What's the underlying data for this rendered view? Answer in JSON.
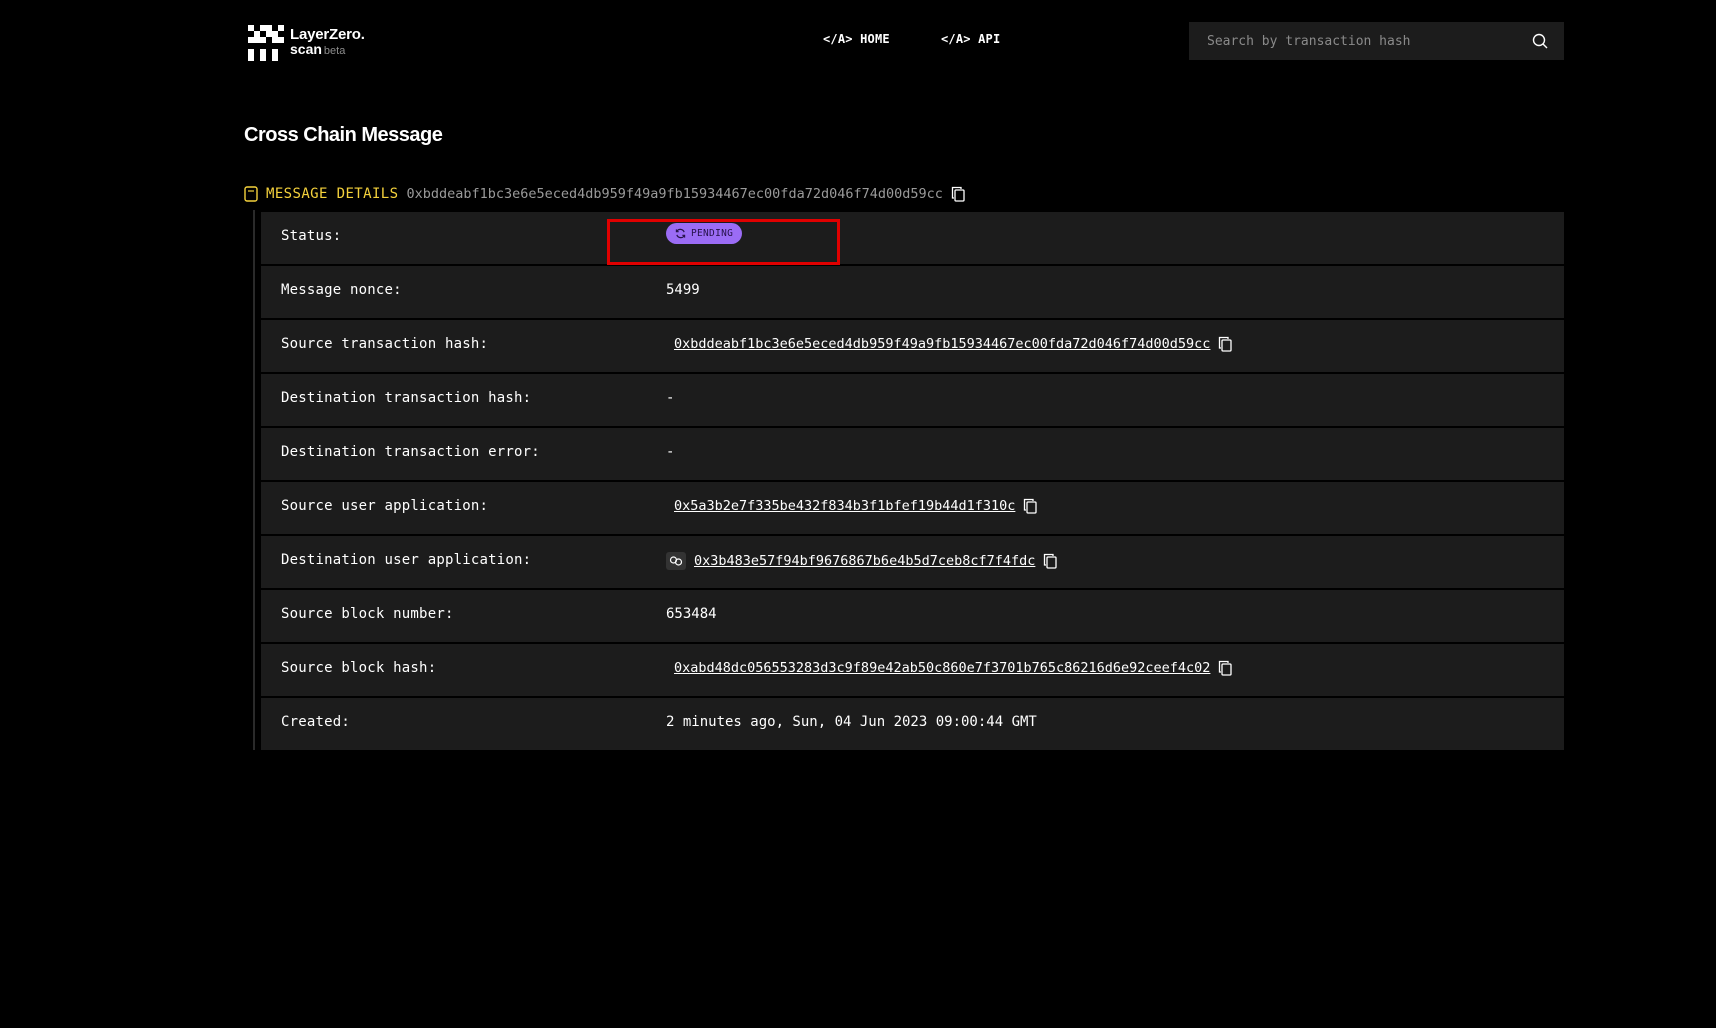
{
  "header": {
    "logo": {
      "line1": "LayerZero.",
      "line2": "scan",
      "tag": "beta"
    },
    "nav": {
      "home": "</A> HOME",
      "api": "</A> API"
    },
    "search": {
      "placeholder": "Search by transaction hash"
    }
  },
  "page": {
    "title": "Cross Chain Message"
  },
  "message_details": {
    "label": "MESSAGE DETAILS",
    "hash": "0xbddeabf1bc3e6e5eced4db959f49a9fb15934467ec00fda72d046f74d00d59cc"
  },
  "rows": {
    "status": {
      "label": "Status:",
      "value": "PENDING"
    },
    "nonce": {
      "label": "Message nonce:",
      "value": "5499"
    },
    "src_tx": {
      "label": "Source transaction hash:",
      "value": "0xbddeabf1bc3e6e5eced4db959f49a9fb15934467ec00fda72d046f74d00d59cc"
    },
    "dst_tx": {
      "label": "Destination transaction hash:",
      "value": "-"
    },
    "dst_err": {
      "label": "Destination transaction error:",
      "value": "-"
    },
    "src_ua": {
      "label": "Source user application:",
      "value": "0x5a3b2e7f335be432f834b3f1bfef19b44d1f310c"
    },
    "dst_ua": {
      "label": "Destination user application:",
      "value": "0x3b483e57f94bf9676867b6e4b5d7ceb8cf7f4fdc"
    },
    "src_block": {
      "label": "Source block number:",
      "value": "653484"
    },
    "src_block_hash": {
      "label": "Source block hash:",
      "value": "0xabd48dc056553283d3c9f89e42ab50c860e7f3701b765c86216d6e92ceef4c02"
    },
    "created": {
      "label": "Created:",
      "value": "2 minutes ago, Sun, 04 Jun 2023 09:00:44 GMT"
    }
  },
  "colors": {
    "accent": "#f5d23c",
    "pending_badge": "#9b6cf5",
    "highlight_box": "#e00000",
    "row_bg": "#1c1c1c"
  },
  "icons": [
    "layerzero-logo-icon",
    "search-icon",
    "document-icon",
    "copy-icon",
    "refresh-icon",
    "chain-link-icon"
  ]
}
